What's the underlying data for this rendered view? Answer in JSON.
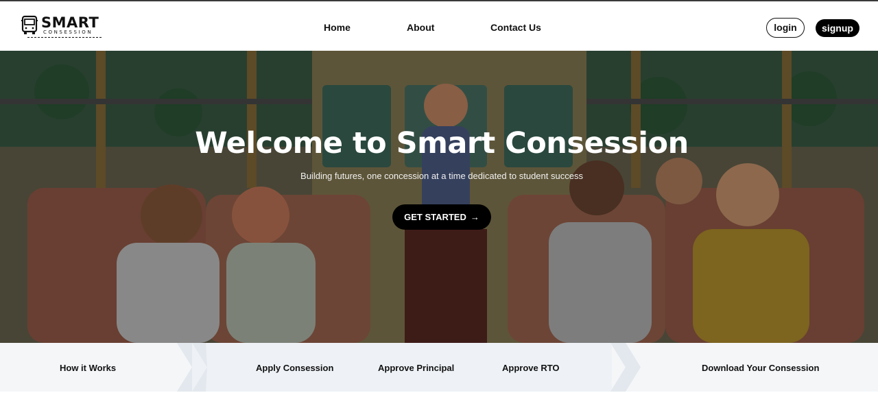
{
  "brand": {
    "name": "SMART",
    "tagline": "CONSESSION"
  },
  "nav": {
    "home": "Home",
    "about": "About",
    "contact": "Contact Us"
  },
  "auth": {
    "login": "login",
    "signup": "signup"
  },
  "hero": {
    "title": "Welcome to Smart Consession",
    "subtitle": "Building futures, one concession at a time dedicated to student success",
    "cta": "GET STARTED",
    "cta_icon": "arrow-right-icon"
  },
  "steps": {
    "how": "How it Works",
    "apply": "Apply Consession",
    "principal": "Approve Principal",
    "rto": "Approve RTO",
    "download": "Download Your Consession"
  },
  "colors": {
    "primary": "#000000",
    "steps_bg": "#f4f6f8",
    "chevron": "#e3e8ee"
  }
}
